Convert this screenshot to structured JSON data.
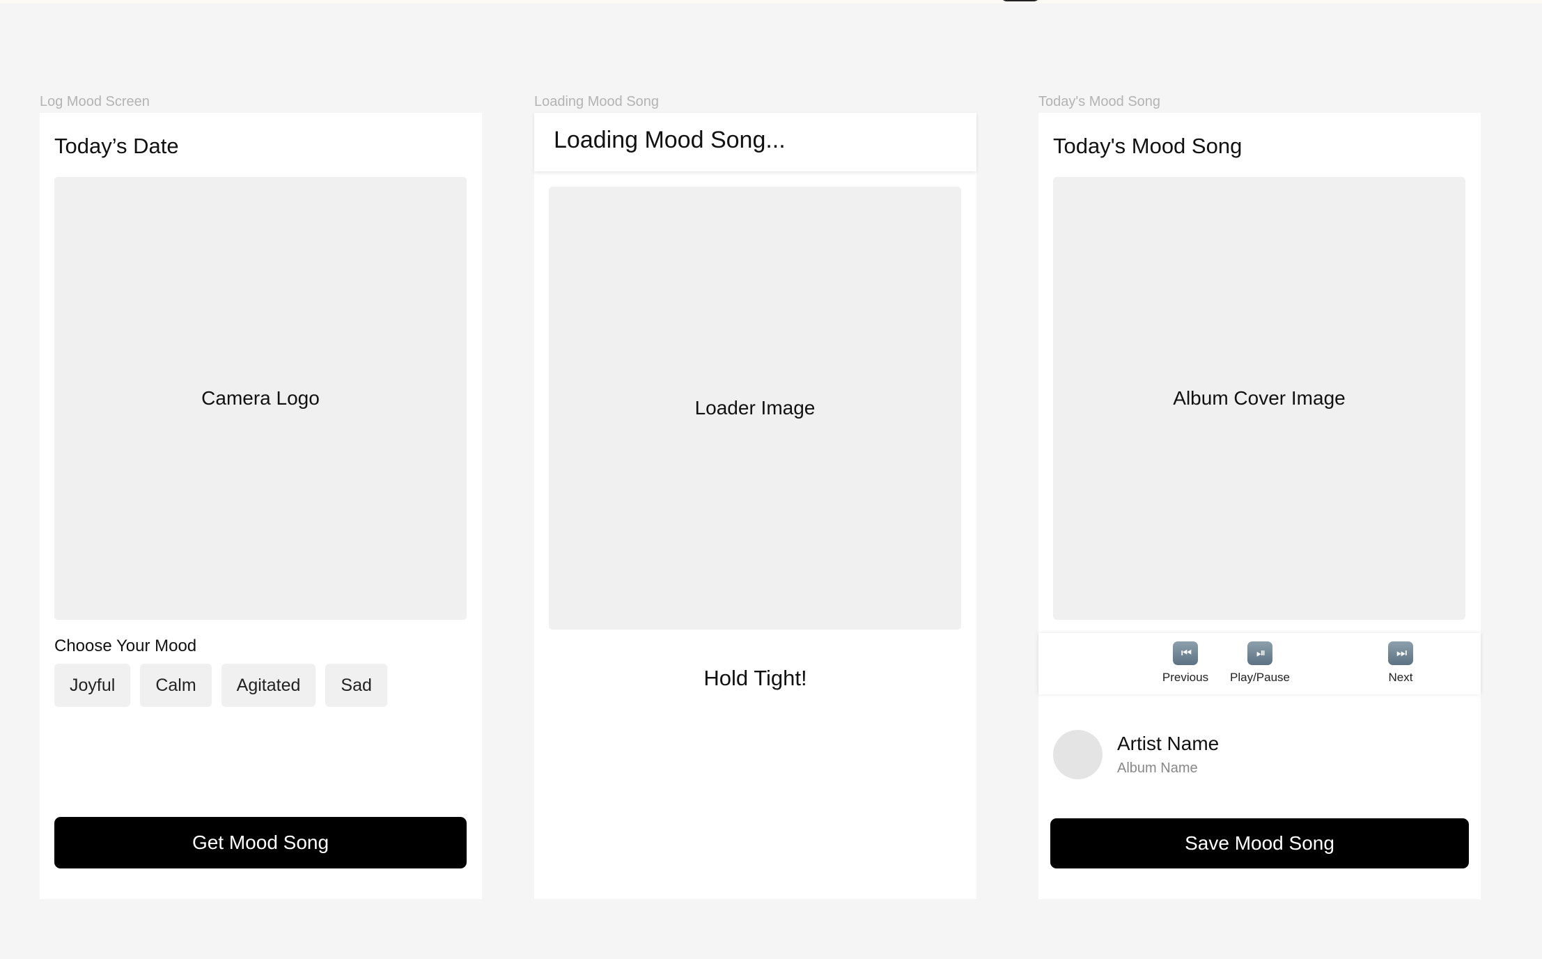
{
  "screens": {
    "log": {
      "frame_label": "Log Mood Screen",
      "title": "Today’s Date",
      "image_placeholder": "Camera Logo",
      "mood_label": "Choose Your Mood",
      "moods": [
        "Joyful",
        "Calm",
        "Agitated",
        "Sad"
      ],
      "cta": "Get Mood Song"
    },
    "loading": {
      "frame_label": "Loading Mood Song",
      "title": "Loading Mood Song...",
      "image_placeholder": "Loader Image",
      "message": "Hold Tight!"
    },
    "song": {
      "frame_label": "Today's Mood Song",
      "title": "Today's Mood Song",
      "image_placeholder": "Album Cover Image",
      "controls": [
        {
          "label": "Previous",
          "icon": "previous-icon",
          "glyph": "⏮"
        },
        {
          "label": "Play/Pause",
          "icon": "play-pause-icon",
          "glyph": "⏯"
        },
        {
          "label": "Next",
          "icon": "next-icon",
          "glyph": "⏭"
        }
      ],
      "artist": "Artist Name",
      "album": "Album Name",
      "cta": "Save Mood Song"
    }
  }
}
